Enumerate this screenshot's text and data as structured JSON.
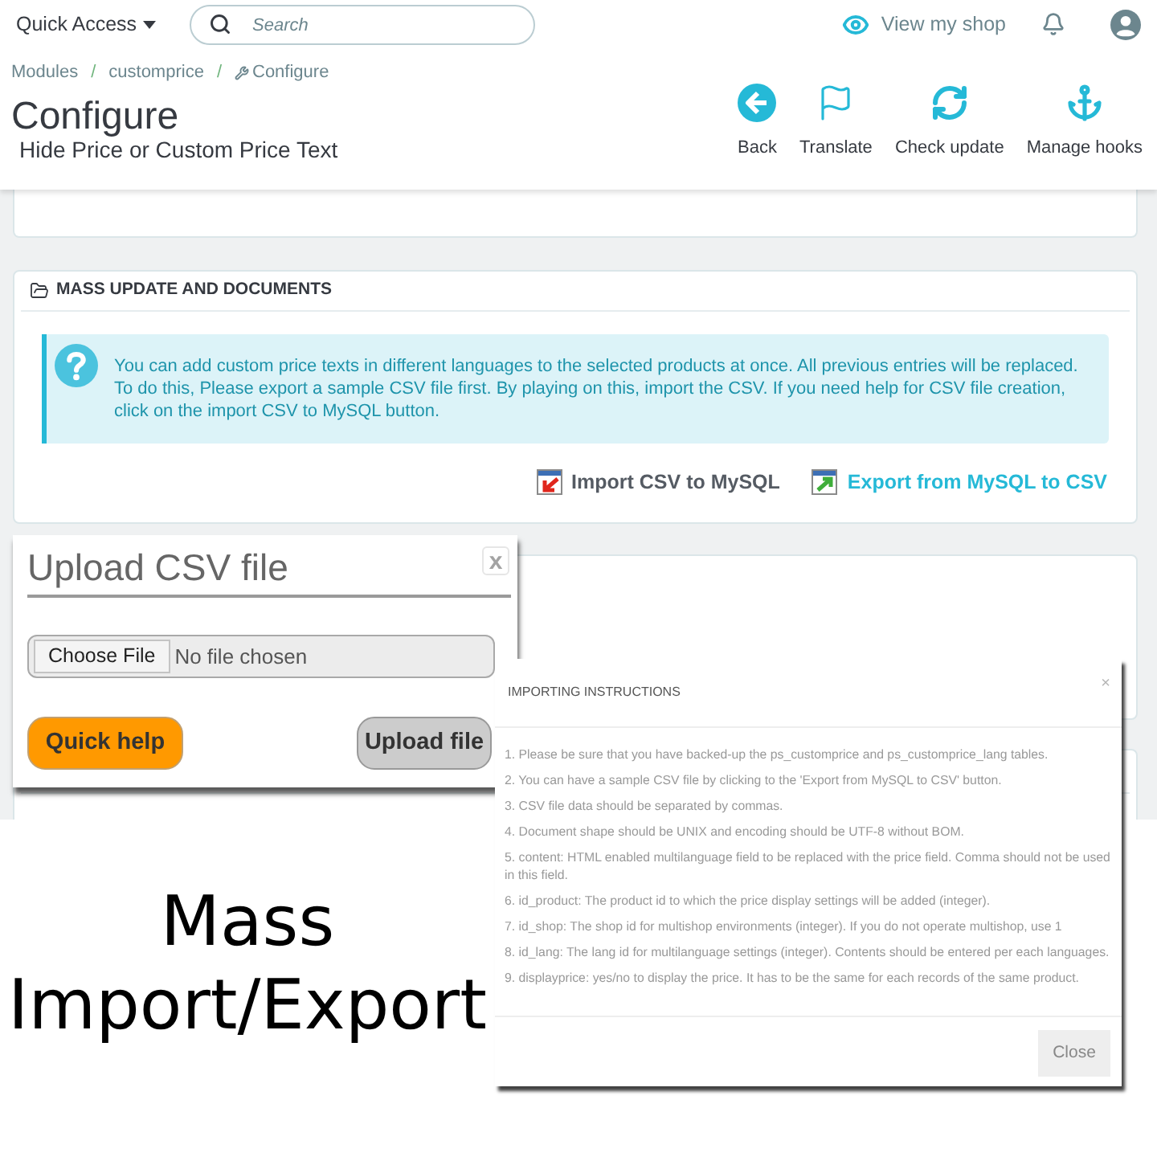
{
  "top_bar": {
    "quick_access": "Quick Access",
    "search": {
      "placeholder": "Search"
    },
    "view_shop": "View my shop"
  },
  "breadcrumb": [
    {
      "label": "Modules",
      "kind": "link",
      "separator": "/"
    },
    {
      "label": "customprice",
      "kind": "link",
      "separator": "/"
    },
    {
      "label": "Configure",
      "kind": "current"
    }
  ],
  "page_header": {
    "title": "Configure",
    "subtitle": "Hide Price or Custom Price Text"
  },
  "toolbar": [
    {
      "label": "Back",
      "kind": "back"
    },
    {
      "label": "Translate",
      "kind": "translate"
    },
    {
      "label": "Check update",
      "kind": "update"
    },
    {
      "label": "Manage hooks",
      "kind": "hooks"
    }
  ],
  "mass_update": {
    "title": "MASS UPDATE AND DOCUMENTS",
    "info": "You can add custom price texts in different languages to the selected products at once. All previous entries will be replaced. To do this, Please export a sample CSV file first. By playing on this, import the CSV. If you need help for CSV file creation, click on the import CSV to MySQL button.",
    "actions": [
      {
        "label": "Import CSV to MySQL",
        "kind": "import"
      },
      {
        "label": "Export from MySQL to CSV",
        "kind": "export"
      }
    ]
  },
  "upload_dialog": {
    "title": "Upload CSV file",
    "close": "x",
    "file_button": "Choose File",
    "file_status": "No file chosen",
    "buttons": [
      {
        "label": "Quick help",
        "kind": "help"
      },
      {
        "label": "Upload file",
        "kind": "upload"
      }
    ]
  },
  "instructions_modal": {
    "title": "IMPORTING INSTRUCTIONS",
    "close": "×",
    "items": [
      "1. Please be sure that you have backed-up the ps_customprice and ps_customprice_lang tables.",
      "2. You can have a sample CSV file by clicking to the 'Export from MySQL to CSV' button.",
      "3. CSV file data should be separated by commas.",
      "4. Document shape should be UNIX and encoding should be UTF-8 without BOM.",
      "5. content: HTML enabled multilanguage field to be replaced with the price field. Comma should not be used in this field.",
      "6. id_product: The product id to which the price display settings will be added (integer).",
      "7. id_shop: The shop id for multishop environments (integer). If you do not operate multishop, use 1",
      "8. id_lang: The lang id for multilanguage settings (integer). Contents should be entered per each languages.",
      "9. displayprice: yes/no to display the price. It has to be the same for each records of the same product."
    ],
    "button": "Close"
  },
  "caption": "Mass Import/Export"
}
